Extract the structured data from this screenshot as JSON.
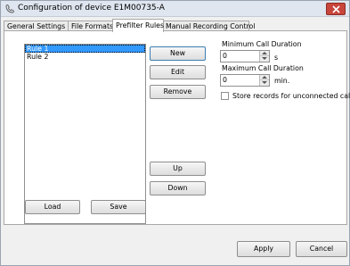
{
  "window": {
    "title": "Configuration of device E1M00735-A"
  },
  "tabs": [
    {
      "label": "General Settings",
      "active": false
    },
    {
      "label": "File Formats",
      "active": false
    },
    {
      "label": "Prefilter Rules",
      "active": true
    },
    {
      "label": "Manual Recording Control",
      "active": false
    }
  ],
  "rules_list": {
    "items": [
      "Rule 1",
      "Rule 2"
    ],
    "selected_index": 0
  },
  "buttons": {
    "new": "New",
    "edit": "Edit",
    "remove": "Remove",
    "up": "Up",
    "down": "Down",
    "load": "Load",
    "save": "Save",
    "apply": "Apply",
    "cancel": "Cancel"
  },
  "min_duration": {
    "label": "Minimum Call Duration",
    "value": "0",
    "unit": "s"
  },
  "max_duration": {
    "label": "Maximum Call Duration",
    "value": "0",
    "unit": "min."
  },
  "unconnected": {
    "label": "Store records for unconnected calls",
    "checked": false
  },
  "colors": {
    "selection": "#3399ff",
    "close_button": "#c8453b",
    "titlebar": "#dfe6ef"
  }
}
